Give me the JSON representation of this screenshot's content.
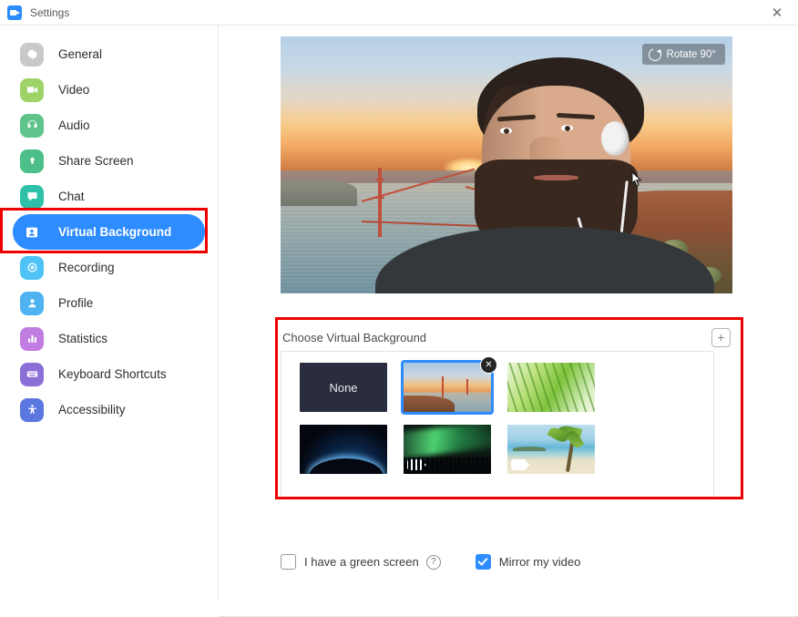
{
  "window": {
    "title": "Settings",
    "logo_icon": "zoom-camera-icon",
    "close_icon": "close-icon"
  },
  "sidebar": {
    "items": [
      {
        "label": "General",
        "icon": "gear-icon",
        "color": "#c9c9c9",
        "active": false
      },
      {
        "label": "Video",
        "icon": "camera-icon",
        "color": "#9ed36a",
        "active": false
      },
      {
        "label": "Audio",
        "icon": "headset-icon",
        "color": "#5fc48a",
        "active": false
      },
      {
        "label": "Share Screen",
        "icon": "upload-icon",
        "color": "#4cbf88",
        "active": false
      },
      {
        "label": "Chat",
        "icon": "chat-icon",
        "color": "#2fc0a8",
        "active": false
      },
      {
        "label": "Virtual Background",
        "icon": "person-card-icon",
        "color": "#2d8cff",
        "active": true
      },
      {
        "label": "Recording",
        "icon": "record-icon",
        "color": "#4fc3f7",
        "active": false
      },
      {
        "label": "Profile",
        "icon": "user-icon",
        "color": "#4fb3f2",
        "active": false
      },
      {
        "label": "Statistics",
        "icon": "bar-chart-icon",
        "color": "#c07ce0",
        "active": false
      },
      {
        "label": "Keyboard Shortcuts",
        "icon": "keyboard-icon",
        "color": "#8b6fd6",
        "active": false
      },
      {
        "label": "Accessibility",
        "icon": "accessibility-icon",
        "color": "#5b77e0",
        "active": false
      }
    ]
  },
  "preview": {
    "rotate_button_label": "Rotate 90°",
    "rotate_icon": "rotate-icon",
    "cursor_icon": "mouse-pointer-icon"
  },
  "virtual_background": {
    "section_title": "Choose Virtual Background",
    "add_button_icon": "plus-icon",
    "thumbnails": [
      {
        "label": "None",
        "type": "none",
        "selected": false,
        "has_video_badge": false
      },
      {
        "label": "Golden Gate Bridge",
        "type": "image",
        "selected": true,
        "has_video_badge": false,
        "remove_badge": "✕"
      },
      {
        "label": "Grass",
        "type": "image",
        "selected": false,
        "has_video_badge": false
      },
      {
        "label": "Earth from space",
        "type": "image",
        "selected": false,
        "has_video_badge": false
      },
      {
        "label": "Aurora forest",
        "type": "video",
        "selected": false,
        "has_video_badge": true
      },
      {
        "label": "Tropical beach",
        "type": "video",
        "selected": false,
        "has_video_badge": true
      }
    ]
  },
  "options": {
    "green_screen": {
      "label": "I have a green screen",
      "checked": false,
      "help_icon": "question-mark-icon",
      "help_glyph": "?"
    },
    "mirror_video": {
      "label": "Mirror my video",
      "checked": true
    }
  },
  "colors": {
    "accent": "#2d8cff",
    "annotation": "#ee0000",
    "text": "#2d2d2d"
  }
}
